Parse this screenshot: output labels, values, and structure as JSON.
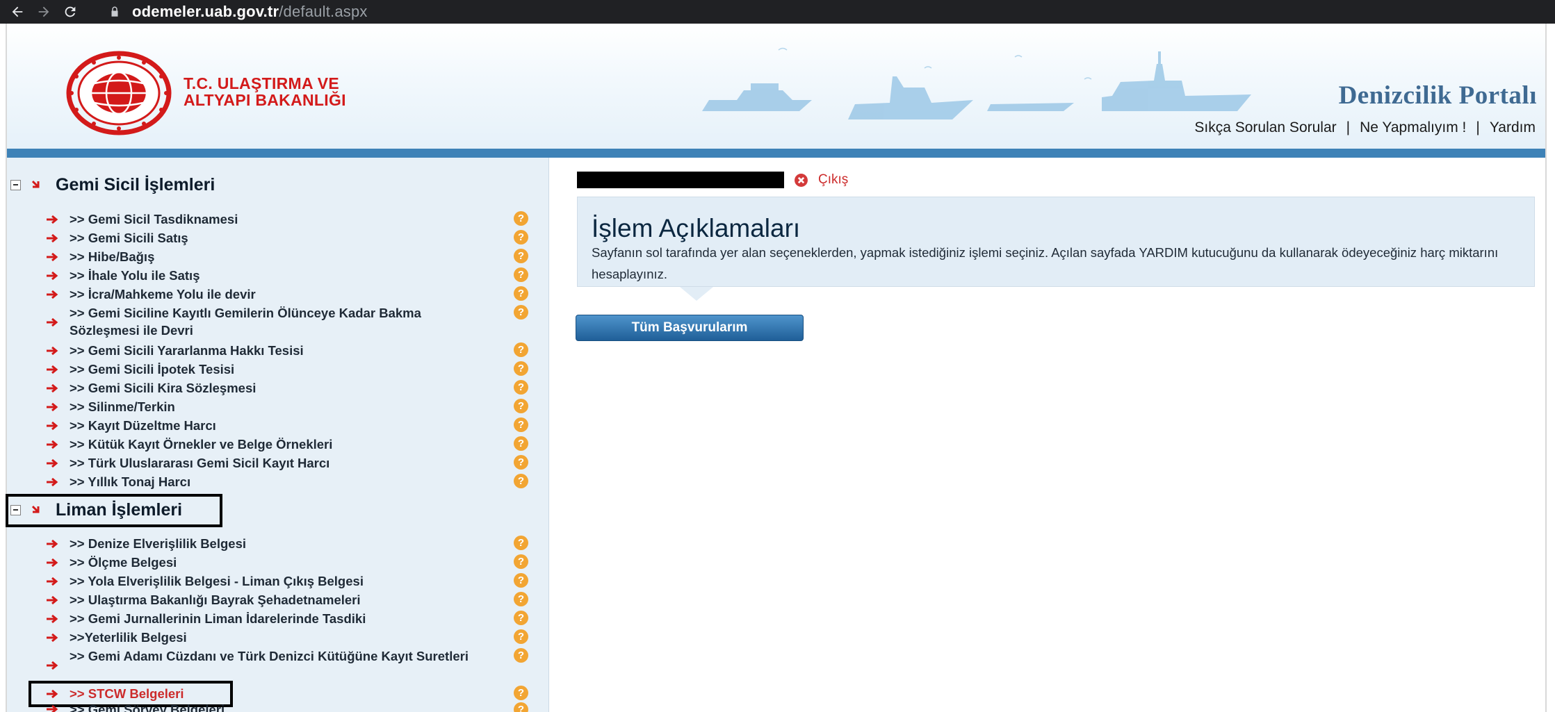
{
  "browser": {
    "url_host": "odemeler.uab.gov.tr",
    "url_path": "/default.aspx"
  },
  "header": {
    "ministry_line1": "T.C. ULAŞTIRMA VE",
    "ministry_line2": "ALTYAPI BAKANLIĞI",
    "portal_title": "Denizcilik Portalı",
    "links": [
      "Sıkça Sorulan Sorular",
      "Ne Yapmalıyım !",
      "Yardım"
    ],
    "link_separator": "|"
  },
  "sidebar": {
    "sections": [
      {
        "title": "Gemi Sicil İşlemleri",
        "items": [
          ">> Gemi Sicil Tasdiknamesi",
          ">> Gemi Sicili Satış",
          ">> Hibe/Bağış",
          ">> İhale Yolu ile Satış",
          ">> İcra/Mahkeme Yolu ile devir",
          ">> Gemi Siciline Kayıtlı Gemilerin Ölünceye Kadar Bakma Sözleşmesi ile Devri",
          ">> Gemi Sicili Yararlanma Hakkı Tesisi",
          ">> Gemi Sicili İpotek Tesisi",
          ">> Gemi Sicili Kira Sözleşmesi",
          ">> Silinme/Terkin",
          ">> Kayıt Düzeltme Harcı",
          ">> Kütük Kayıt Örnekler ve Belge Örnekleri",
          ">> Türk Uluslararası Gemi Sicil Kayıt Harcı",
          ">> Yıllık Tonaj Harcı"
        ]
      },
      {
        "title": "Liman İşlemleri",
        "items": [
          ">> Denize Elverişlilik Belgesi",
          ">> Ölçme Belgesi",
          ">> Yola Elverişlilik Belgesi - Liman Çıkış Belgesi",
          ">> Ulaştırma Bakanlığı Bayrak Şehadetnameleri",
          ">> Gemi Jurnallerinin Liman İdarelerinde Tasdiki",
          ">>Yeterlilik Belgesi",
          ">> Gemi Adamı Cüzdanı ve Türk Denizci Kütüğüne Kayıt Suretleri",
          ">> STCW Belgeleri",
          ">> Gemi Sörvey Belgeleri"
        ]
      }
    ],
    "help_glyph": "?"
  },
  "main": {
    "logout_label": "Çıkış",
    "info_title": "İşlem Açıklamaları",
    "info_text": "Sayfanın sol tarafında yer alan seçeneklerden, yapmak istediğiniz işlemi seçiniz. Açılan sayfada YARDIM kutucuğunu da kullanarak ödeyeceğiniz harç miktarını hesaplayınız.",
    "all_apps_button": "Tüm Başvurularım"
  },
  "colors": {
    "accent_blue": "#3e82b7",
    "menu_bg": "#e7f0f7",
    "red": "#d31a1a",
    "help_orange": "#f2a533",
    "highlighted_item": "#cc2b2b"
  },
  "icons": {
    "back": "arrow-left-icon",
    "forward": "arrow-right-icon",
    "reload": "reload-icon",
    "lock": "lock-icon",
    "logout": "close-circle-icon",
    "menu_arrow": "red-arrow-icon",
    "help": "help-icon"
  }
}
